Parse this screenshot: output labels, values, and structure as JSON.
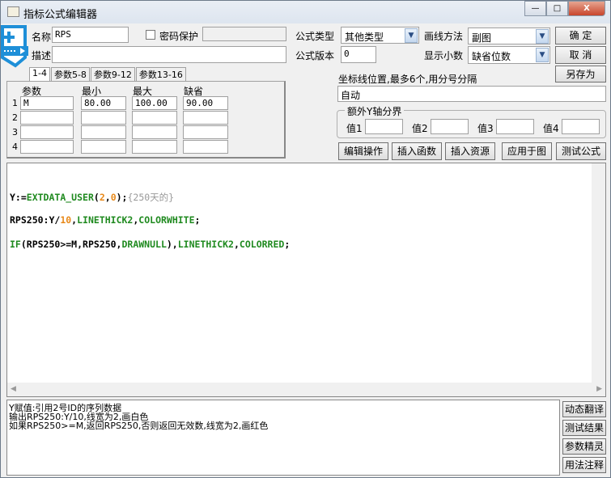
{
  "window": {
    "title": "指标公式编辑器",
    "minimize": "—",
    "maximize": "□",
    "close": "X"
  },
  "form": {
    "name_label": "名称",
    "name_value": "RPS",
    "password_label": "密码保护",
    "password_checked": false,
    "desc_label": "描述",
    "desc_value": "",
    "formula_type_label": "公式类型",
    "formula_type_value": "其他类型",
    "draw_method_label": "画线方法",
    "draw_method_value": "副图",
    "version_label": "公式版本",
    "version_value": "0",
    "decimals_label": "显示小数",
    "decimals_value": "缺省位数",
    "axis_label": "坐标线位置,最多6个,用分号分隔",
    "axis_value": "自动",
    "yaxis_group": "额外Y轴分界",
    "yvals": [
      {
        "label": "值1",
        "value": ""
      },
      {
        "label": "值2",
        "value": ""
      },
      {
        "label": "值3",
        "value": ""
      },
      {
        "label": "值4",
        "value": ""
      }
    ]
  },
  "buttons": {
    "ok": "确  定",
    "cancel": "取  消",
    "save_as": "另存为",
    "edit_ops": "编辑操作",
    "insert_func": "插入函数",
    "insert_res": "插入资源",
    "apply": "应用于图",
    "test": "测试公式"
  },
  "param_tabs": [
    "1-4",
    "参数5-8",
    "参数9-12",
    "参数13-16"
  ],
  "params": {
    "headers": [
      "参数",
      "最小",
      "最大",
      "缺省"
    ],
    "rows": [
      {
        "n": "1",
        "name": "M",
        "min": "80.00",
        "max": "100.00",
        "def": "90.00"
      },
      {
        "n": "2",
        "name": "",
        "min": "",
        "max": "",
        "def": ""
      },
      {
        "n": "3",
        "name": "",
        "min": "",
        "max": "",
        "def": ""
      },
      {
        "n": "4",
        "name": "",
        "min": "",
        "max": "",
        "def": ""
      }
    ]
  },
  "code": {
    "l1": {
      "a": "Y:=",
      "b": "EXTDATA_USER",
      "c": "(",
      "d": "2",
      ",": ",",
      "e": "0",
      "f": ");",
      "g": "{250天的}"
    },
    "l2": {
      "a": "RPS250:Y/",
      "b": "10",
      "c": ",",
      "d": "LINETHICK2",
      ",": ",",
      "e": "COLORWHITE",
      "f": ";"
    },
    "l3": {
      "a": "IF",
      "b": "(RPS250>=M,RPS250,",
      "c": "DRAWNULL",
      "d": "),",
      "e": "LINETHICK2",
      ",": ",",
      "f": "COLORRED",
      "g": ";"
    }
  },
  "description": [
    "Y赋值:引用2号ID的序列数据",
    "输出RPS250:Y/10,线宽为2,画白色",
    "如果RPS250>=M,返回RPS250,否则返回无效数,线宽为2,画红色"
  ],
  "side_buttons": [
    "动态翻译",
    "测试结果",
    "参数精灵",
    "用法注释"
  ],
  "colors": {
    "keyword": "#1f8a1f",
    "number": "#e8891a",
    "comment": "#999999",
    "overlay_icon": "#1e8fd8"
  }
}
